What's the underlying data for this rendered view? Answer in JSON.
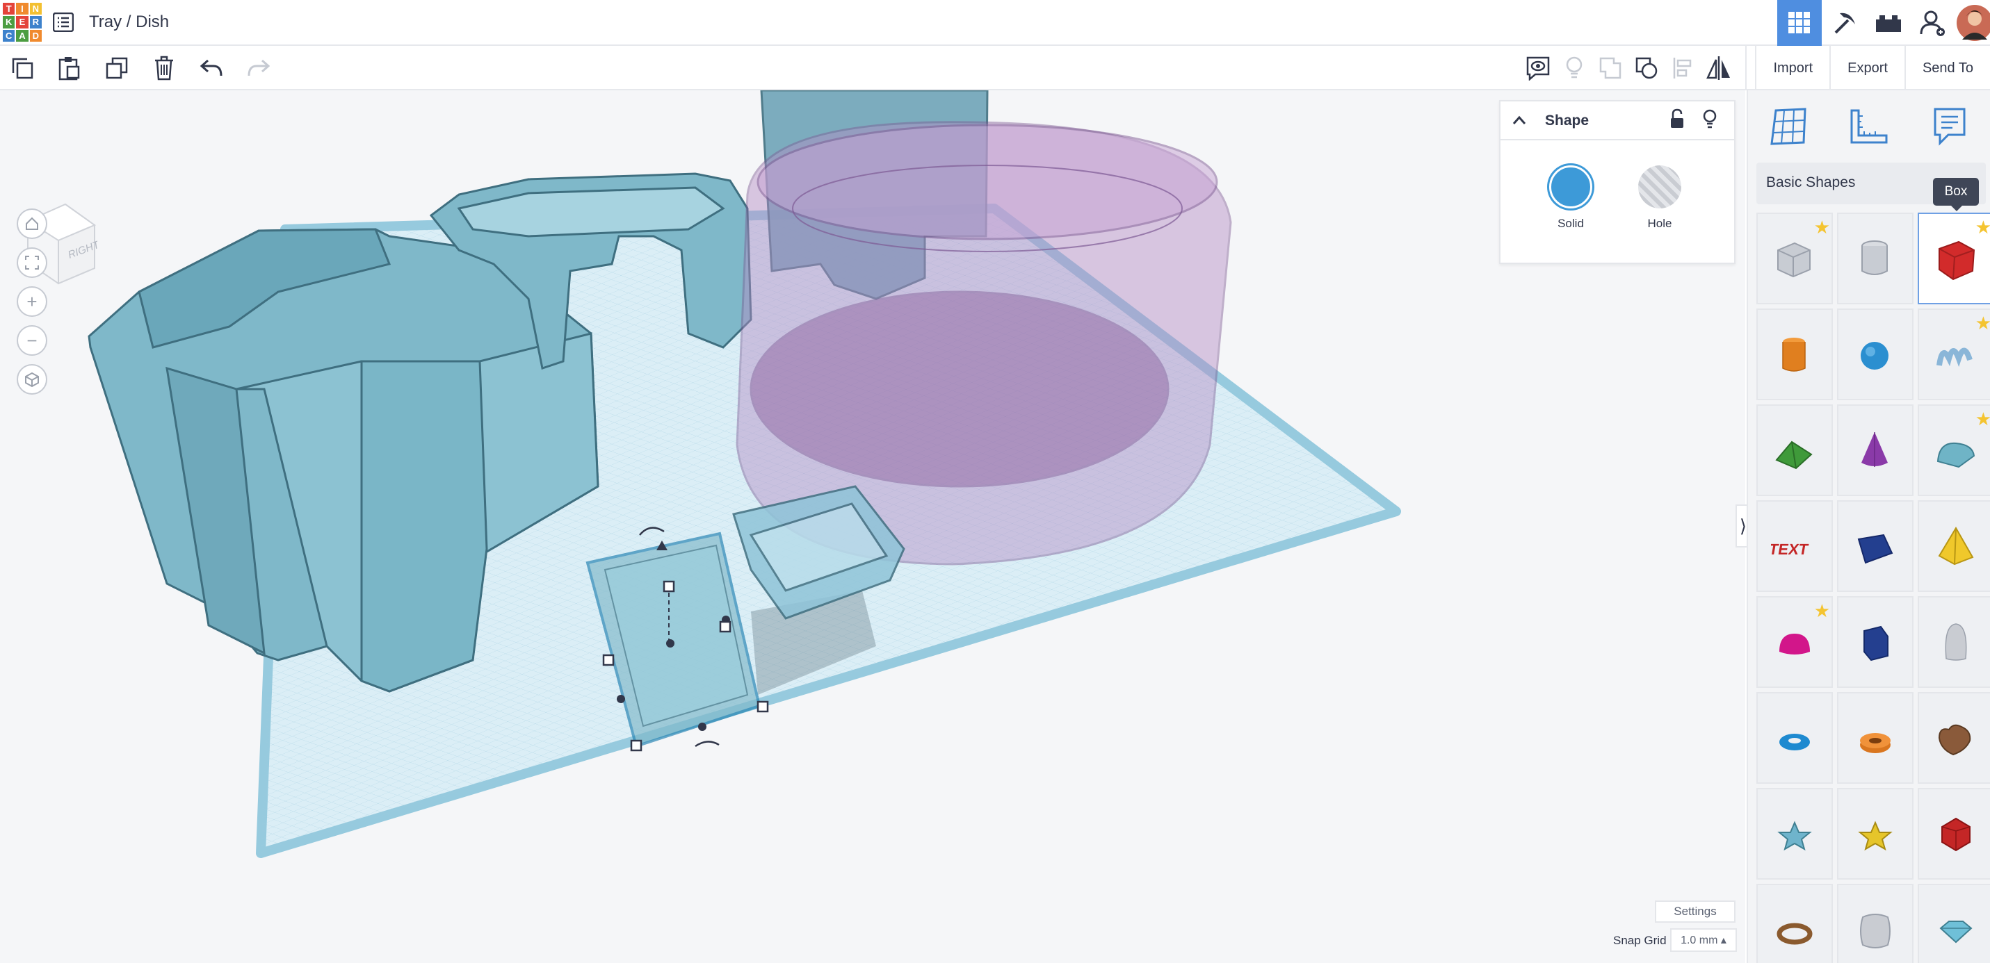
{
  "app": {
    "name": "Tinkercad",
    "logo_letters": [
      "T",
      "I",
      "N",
      "K",
      "E",
      "R",
      "C",
      "A",
      "D"
    ],
    "logo_colors": [
      "#e4433a",
      "#f08a2e",
      "#f3c031",
      "#4c9d41",
      "#e4433a",
      "#3d82cc",
      "#3d82cc",
      "#4c9d41",
      "#f08a2e"
    ]
  },
  "header": {
    "title": "Tray / Dish"
  },
  "toolbar": {
    "import_label": "Import",
    "export_label": "Export",
    "send_to_label": "Send To"
  },
  "viewcube": {
    "face_label": "RIGHT"
  },
  "inspector": {
    "title": "Shape",
    "solid_label": "Solid",
    "hole_label": "Hole",
    "solid_color": "#3d9ad8"
  },
  "panel": {
    "library": "Basic Shapes",
    "tooltip": "Box"
  },
  "shapes": [
    {
      "name": "Box (hole)",
      "icon": "box-hole-icon",
      "starred": true
    },
    {
      "name": "Cylinder (hole)",
      "icon": "cylinder-hole-icon",
      "starred": false
    },
    {
      "name": "Box",
      "icon": "box-icon",
      "starred": true,
      "selected": true
    },
    {
      "name": "Cylinder",
      "icon": "cylinder-icon",
      "starred": false
    },
    {
      "name": "Sphere",
      "icon": "sphere-icon",
      "starred": false
    },
    {
      "name": "Scribble",
      "icon": "scribble-icon",
      "starred": true
    },
    {
      "name": "Roof",
      "icon": "roof-icon",
      "starred": false
    },
    {
      "name": "Cone",
      "icon": "cone-icon",
      "starred": false
    },
    {
      "name": "Round Roof",
      "icon": "round-roof-icon",
      "starred": true
    },
    {
      "name": "Text",
      "icon": "text-icon",
      "starred": false
    },
    {
      "name": "Wedge",
      "icon": "wedge-icon",
      "starred": false
    },
    {
      "name": "Pyramid",
      "icon": "pyramid-icon",
      "starred": false
    },
    {
      "name": "Half Sphere",
      "icon": "half-sphere-icon",
      "starred": true
    },
    {
      "name": "Polygon",
      "icon": "polygon-icon",
      "starred": false
    },
    {
      "name": "Paraboloid",
      "icon": "paraboloid-icon",
      "starred": false
    },
    {
      "name": "Torus",
      "icon": "torus-icon",
      "starred": false
    },
    {
      "name": "Tube",
      "icon": "tube-icon",
      "starred": false
    },
    {
      "name": "Heart",
      "icon": "heart-icon",
      "starred": false
    },
    {
      "name": "Star",
      "icon": "star-shape-icon",
      "starred": false
    },
    {
      "name": "Star (yellow)",
      "icon": "star-yellow-icon",
      "starred": false
    },
    {
      "name": "Icosahedron",
      "icon": "icosahedron-icon",
      "starred": false
    },
    {
      "name": "Ring",
      "icon": "ring-icon",
      "starred": false
    },
    {
      "name": "Rounded Box",
      "icon": "rounded-box-icon",
      "starred": false
    },
    {
      "name": "Diamond",
      "icon": "diamond-icon",
      "starred": false
    }
  ],
  "bottom": {
    "settings_label": "Settings",
    "snap_label": "Snap Grid",
    "snap_value": "1.0 mm ▴"
  },
  "colors": {
    "accent": "#4f8ee0",
    "teal_shape": "#7fb8c9",
    "hole_purple": "#b48bc4"
  }
}
